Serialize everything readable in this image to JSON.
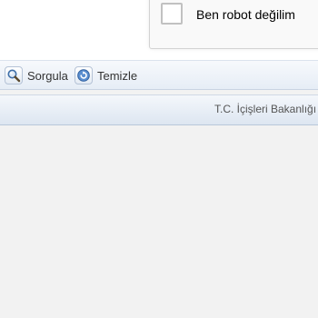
{
  "captcha": {
    "label": "Ben robot değilim",
    "checked": false
  },
  "toolbar": {
    "query_label": "Sorgula",
    "query_icon": "magnifier-icon",
    "clear_label": "Temizle",
    "clear_icon": "refresh-icon"
  },
  "footer": {
    "text": "T.C. İçişleri Bakanlığı -"
  }
}
